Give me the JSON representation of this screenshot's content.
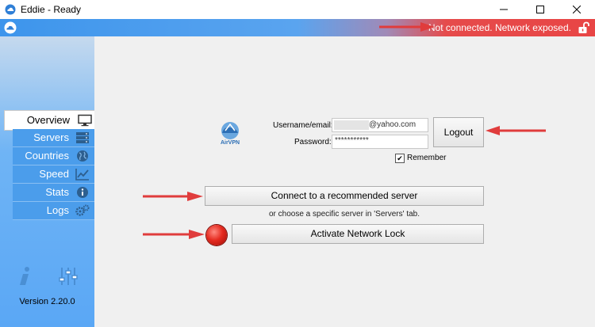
{
  "window": {
    "title": "Eddie - Ready",
    "controls": [
      "minimize",
      "maximize",
      "close"
    ]
  },
  "status_bar": {
    "text": "Not connected. Network exposed.",
    "lock_icon": "unlocked-padlock-icon",
    "colors": {
      "left": "#3d95ec",
      "right": "#e84545"
    }
  },
  "sidebar": {
    "items": [
      {
        "label": "Overview",
        "icon": "monitor-icon",
        "selected": true
      },
      {
        "label": "Servers",
        "icon": "servers-icon",
        "selected": false
      },
      {
        "label": "Countries",
        "icon": "globe-icon",
        "selected": false
      },
      {
        "label": "Speed",
        "icon": "chart-icon",
        "selected": false
      },
      {
        "label": "Stats",
        "icon": "info-circle-icon",
        "selected": false
      },
      {
        "label": "Logs",
        "icon": "gears-icon",
        "selected": false
      }
    ],
    "version": "Version 2.20.0"
  },
  "login": {
    "logo_text": "AirVPN",
    "username_label": "Username/email:",
    "username_domain": "@yahoo.com",
    "password_label": "Password:",
    "password_mask": "***********",
    "logout_label": "Logout",
    "remember_label": "Remember",
    "remember_checked": true
  },
  "actions": {
    "connect_label": "Connect to a recommended server",
    "choose_hint": "or choose a specific server in 'Servers' tab.",
    "network_lock_label": "Activate Network Lock"
  },
  "annotation_color": "#e03c3c"
}
